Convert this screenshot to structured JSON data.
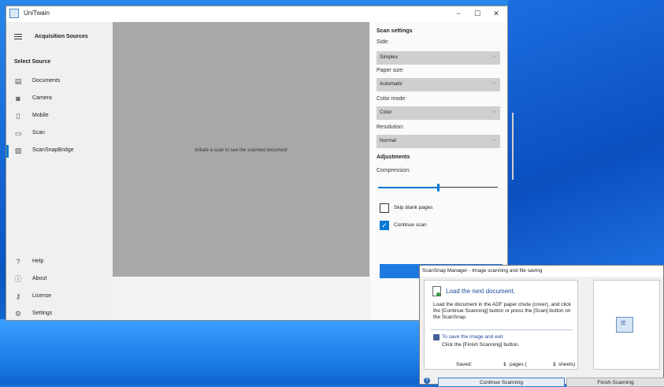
{
  "window": {
    "title": "UniTwain",
    "controls": {
      "minimize": "−",
      "maximize": "☐",
      "close": "✕"
    }
  },
  "sidebar": {
    "header": "Acquisition Sources",
    "select_source": "Select Source",
    "items": [
      {
        "label": "Documents",
        "icon": "document-icon"
      },
      {
        "label": "Camera",
        "icon": "camera-icon"
      },
      {
        "label": "Mobile",
        "icon": "mobile-icon"
      },
      {
        "label": "Scan",
        "icon": "scanner-icon"
      },
      {
        "label": "ScanSnapBridge",
        "icon": "scansnap-icon",
        "active": true
      }
    ],
    "footer": [
      {
        "label": "Help",
        "icon": "help-icon"
      },
      {
        "label": "About",
        "icon": "info-icon"
      },
      {
        "label": "License",
        "icon": "key-icon"
      },
      {
        "label": "Settings",
        "icon": "gear-icon"
      }
    ]
  },
  "preview": {
    "message": "Initiate a scan to see the scanned document"
  },
  "settings": {
    "title": "Scan settings",
    "side": {
      "label": "Side:",
      "value": "Simplex"
    },
    "paper": {
      "label": "Paper size:",
      "value": "Automatic"
    },
    "color": {
      "label": "Color mode:",
      "value": "Color"
    },
    "resolution": {
      "label": "Resolution:",
      "value": "Normal"
    },
    "adjustments": "Adjustments",
    "compression": {
      "label": "Compression:",
      "value": 0.5
    },
    "skip_blank": {
      "label": "Skip blank pages",
      "checked": false
    },
    "continue_scan": {
      "label": "Continue scan",
      "checked": true
    },
    "scan_button": "Scan"
  },
  "dialog": {
    "title": "ScanSnap Manager - Image scanning and file saving",
    "heading": "Load the next document.",
    "description": "Load the document in the ADF paper chute (cover), and click the [Continue Scanning] button or press the [Scan] button on the ScanSnap.",
    "save_heading": "To save the image and exit",
    "save_desc": "Click the [Finish Scanning] button.",
    "saved_label": "Saved:",
    "pages_value": "1",
    "pages_unit": "pages (",
    "sheets_value": "1",
    "sheets_unit": "sheets)",
    "continue_button": "Continue Scanning",
    "finish_button": "Finish Scanning",
    "help": "?"
  },
  "colors": {
    "accent": "#0078d4",
    "preview_bg": "#a8a8a8"
  }
}
